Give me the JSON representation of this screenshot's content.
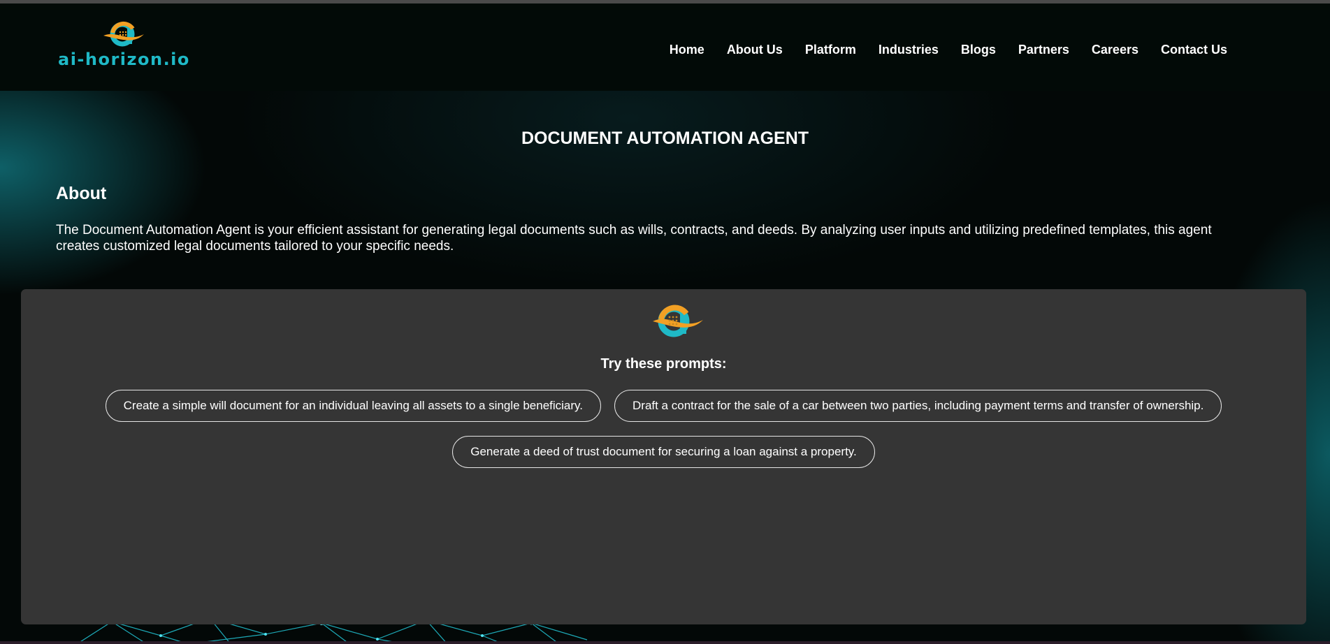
{
  "brand": {
    "logo_text": "ai-horizon.io",
    "colors": {
      "orange": "#f2a024",
      "teal": "#1fb9c6"
    }
  },
  "nav": {
    "items": [
      {
        "label": "Home"
      },
      {
        "label": "About Us"
      },
      {
        "label": "Platform"
      },
      {
        "label": "Industries"
      },
      {
        "label": "Blogs"
      },
      {
        "label": "Partners"
      },
      {
        "label": "Careers"
      },
      {
        "label": "Contact Us"
      }
    ]
  },
  "hero": {
    "title": "DOCUMENT AUTOMATION AGENT",
    "about_heading": "About",
    "about_text": "The Document Automation Agent is your efficient assistant for generating legal documents such as wills, contracts, and deeds. By analyzing user inputs and utilizing predefined templates, this agent creates customized legal documents tailored to your specific needs."
  },
  "chat": {
    "prompts_label": "Try these prompts:",
    "prompts": [
      "Create a simple will document for an individual leaving all assets to a single beneficiary.",
      "Draft a contract for the sale of a car between two parties, including payment terms and transfer of ownership.",
      "Generate a deed of trust document for securing a loan against a property."
    ]
  }
}
